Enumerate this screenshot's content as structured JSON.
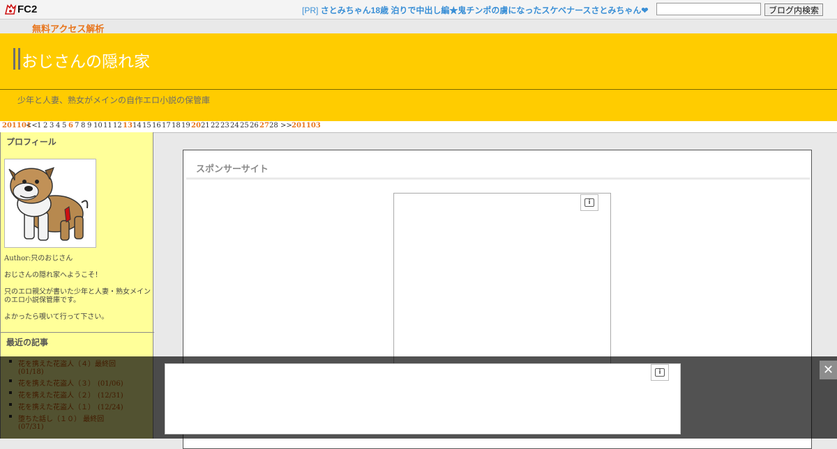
{
  "fc2bar": {
    "logo_text": "FC2",
    "pr_prefix": "[PR] ",
    "pr_text": "さとみちゃん18歳 泊りで中出し編★鬼チンポの虜になったスケベナースさとみちゃん❤",
    "search_value": "",
    "search_button": "ブログ内検索"
  },
  "access_link": "無料アクセス解析",
  "header": {
    "title": "おじさんの隠れ家",
    "tagline": "少年と人妻、熟女がメインの自作エロ小説の保管庫",
    "background_color": "#ffcc00"
  },
  "calendar": {
    "prev_month": "201101",
    "prev_arrow": "<<",
    "next_arrow": ">>",
    "next_month": "201103",
    "days": [
      "1",
      "2",
      "3",
      "4",
      "5",
      "6",
      "7",
      "8",
      "9",
      "10",
      "11",
      "12",
      "13",
      "14",
      "15",
      "16",
      "17",
      "18",
      "19",
      "20",
      "21",
      "22",
      "23",
      "24",
      "25",
      "26",
      "27",
      "28"
    ],
    "highlighted_days": [
      "6",
      "13",
      "20",
      "27"
    ]
  },
  "sidebar": {
    "profile_heading": "プロフィール",
    "author_line": "Author:只のおじさん",
    "welcome": "おじさんの隠れ家へようこそ！",
    "description": "只のエロ親父が書いた少年と人妻・熟女メインのエロ小説保管庫です。",
    "invite": "よかったら覗いて行って下さい。",
    "recent_heading": "最近の記事",
    "recent_items": [
      {
        "title": "花を携えた花盗人（４）最終回",
        "date": "(01/18)"
      },
      {
        "title": "花を携えた花盗人（３）",
        "date": "(01/06)"
      },
      {
        "title": "花を携えた花盗人（２）",
        "date": "(12/31)"
      },
      {
        "title": "花を携えた花盗人（１）",
        "date": "(12/24)"
      },
      {
        "title": "堕ちた話し（１０） 最終回",
        "date": "(07/31)"
      }
    ]
  },
  "main": {
    "sponsor_title": "スポンサーサイト"
  },
  "icons": {
    "ad_info": "ad-info-icon",
    "close": "close-icon",
    "profile": "bulldog-icon"
  },
  "overlay_close": "✕"
}
